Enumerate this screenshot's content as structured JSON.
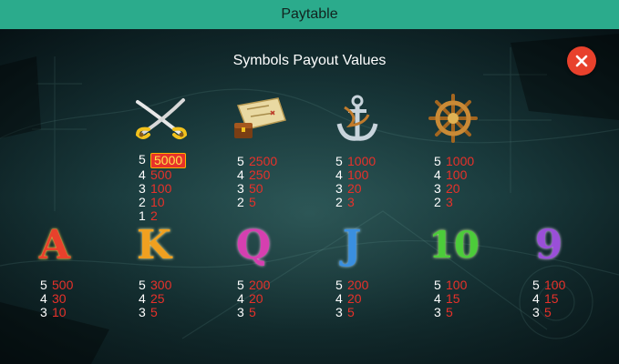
{
  "header": {
    "title": "Paytable"
  },
  "subtitle": "Symbols Payout Values",
  "close": {
    "icon": "close-icon"
  },
  "symbols": [
    {
      "id": "swords",
      "icon": "crossed-swords-icon",
      "payouts": [
        {
          "count": "5",
          "value": "5000",
          "highlight": true
        },
        {
          "count": "4",
          "value": "500"
        },
        {
          "count": "3",
          "value": "100"
        },
        {
          "count": "2",
          "value": "10"
        },
        {
          "count": "1",
          "value": "2"
        }
      ]
    },
    {
      "id": "map",
      "icon": "treasure-map-icon",
      "payouts": [
        {
          "count": "5",
          "value": "2500"
        },
        {
          "count": "4",
          "value": "250"
        },
        {
          "count": "3",
          "value": "50"
        },
        {
          "count": "2",
          "value": "5"
        }
      ]
    },
    {
      "id": "anchor",
      "icon": "anchor-icon",
      "payouts": [
        {
          "count": "5",
          "value": "1000"
        },
        {
          "count": "4",
          "value": "100"
        },
        {
          "count": "3",
          "value": "20"
        },
        {
          "count": "2",
          "value": "3"
        }
      ]
    },
    {
      "id": "wheel",
      "icon": "ship-wheel-icon",
      "payouts": [
        {
          "count": "5",
          "value": "1000"
        },
        {
          "count": "4",
          "value": "100"
        },
        {
          "count": "3",
          "value": "20"
        },
        {
          "count": "2",
          "value": "3"
        }
      ]
    },
    {
      "id": "A",
      "label": "A",
      "color": "#e8412c",
      "payouts": [
        {
          "count": "5",
          "value": "500"
        },
        {
          "count": "4",
          "value": "30"
        },
        {
          "count": "3",
          "value": "10"
        }
      ]
    },
    {
      "id": "K",
      "label": "K",
      "color": "#f0a020",
      "payouts": [
        {
          "count": "5",
          "value": "300"
        },
        {
          "count": "4",
          "value": "25"
        },
        {
          "count": "3",
          "value": "5"
        }
      ]
    },
    {
      "id": "Q",
      "label": "Q",
      "color": "#d63fb0",
      "payouts": [
        {
          "count": "5",
          "value": "200"
        },
        {
          "count": "4",
          "value": "20"
        },
        {
          "count": "3",
          "value": "5"
        }
      ]
    },
    {
      "id": "J",
      "label": "J",
      "color": "#3a8fe0",
      "payouts": [
        {
          "count": "5",
          "value": "200"
        },
        {
          "count": "4",
          "value": "20"
        },
        {
          "count": "3",
          "value": "5"
        }
      ]
    },
    {
      "id": "10",
      "label": "10",
      "color": "#4ccc3a",
      "payouts": [
        {
          "count": "5",
          "value": "100"
        },
        {
          "count": "4",
          "value": "15"
        },
        {
          "count": "3",
          "value": "5"
        }
      ]
    },
    {
      "id": "9",
      "label": "9",
      "color": "#9a4fd8",
      "payouts": [
        {
          "count": "5",
          "value": "100"
        },
        {
          "count": "4",
          "value": "15"
        },
        {
          "count": "3",
          "value": "5"
        }
      ]
    }
  ],
  "colors": {
    "header": "#2bab8c",
    "close": "#e8412c",
    "value": "#e8312a",
    "highlight_text": "#ffe34d"
  }
}
